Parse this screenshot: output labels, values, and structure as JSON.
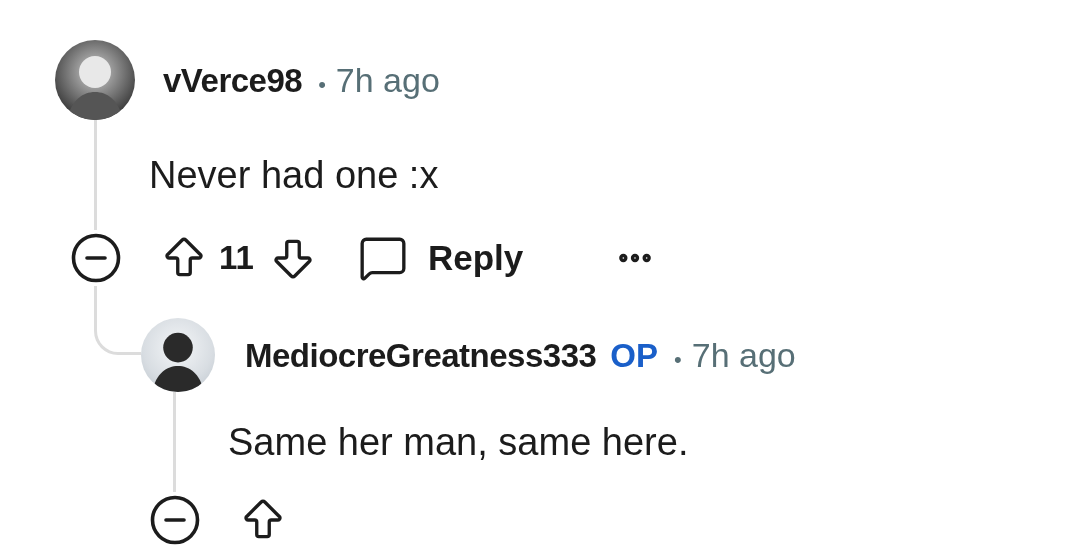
{
  "comments": [
    {
      "author": "vVerce98",
      "separator": "•",
      "time": "7h ago",
      "text": "Never had one :x",
      "votes": "11",
      "reply_label": "Reply",
      "kind": "dark"
    },
    {
      "author": "MediocreGreatness333",
      "badge": "OP",
      "separator": "•",
      "time": "7h ago",
      "text": "Same her man, same here.",
      "kind": "light"
    }
  ]
}
